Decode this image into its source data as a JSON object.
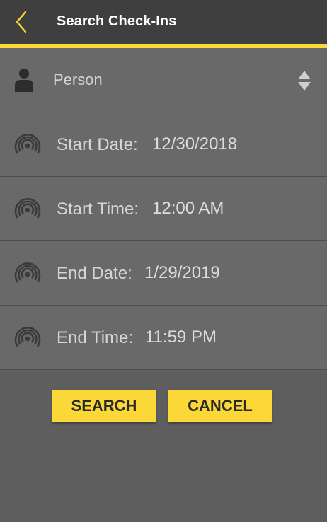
{
  "header": {
    "title": "Search Check-Ins",
    "back_icon": "chevron-left-icon"
  },
  "colors": {
    "accent": "#fbd837",
    "header_bg": "#3f3f3f",
    "row_bg": "#696969",
    "page_bg": "#5e5e5e"
  },
  "person": {
    "placeholder": "Person",
    "icon": "person-icon",
    "dropdown_icon": "sort-arrows-icon"
  },
  "fields": {
    "start_date": {
      "label": "Start Date:",
      "value": "12/30/2018"
    },
    "start_time": {
      "label": "Start Time:",
      "value": "12:00 AM"
    },
    "end_date": {
      "label": "End Date:",
      "value": "1/29/2019"
    },
    "end_time": {
      "label": "End Time:",
      "value": "11:59 PM"
    }
  },
  "buttons": {
    "search": "SEARCH",
    "cancel": "CANCEL"
  }
}
